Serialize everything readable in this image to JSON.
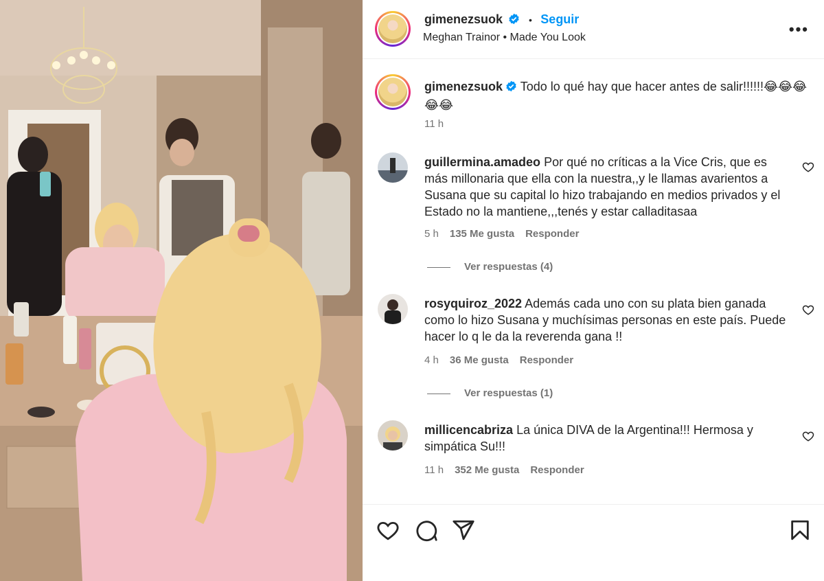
{
  "post": {
    "author": "gimenezsuok",
    "follow_label": "Seguir",
    "dot": "•",
    "song": "Meghan Trainor • Made You Look",
    "more_label": "•••",
    "caption": "Todo lo qué hay que hacer antes de salir!!!!!!😂😂😂😂😂",
    "caption_time": "11 h"
  },
  "comments": [
    {
      "user": "guillermina.amadeo",
      "text": "Por qué no críticas a la Vice Cris, que es más millonaria que ella con la nuestra,,y le llamas avarientos a Susana que su capital lo hizo trabajando en medios privados y el Estado no la mantiene,,,tenés y estar calladitasaa",
      "time": "5 h",
      "likes": "135 Me gusta",
      "reply": "Responder",
      "view_replies": "Ver respuestas (4)"
    },
    {
      "user": "rosyquiroz_2022",
      "text": "Además cada uno con su plata bien ganada como lo hizo Susana y muchísimas personas en este país. Puede hacer lo q le da la reverenda gana !!",
      "time": "4 h",
      "likes": "36 Me gusta",
      "reply": "Responder",
      "view_replies": "Ver respuestas (1)"
    },
    {
      "user": "millicencabriza",
      "text": "La única DIVA de la Argentina!!! Hermosa y simpática Su!!!",
      "time": "11 h",
      "likes": "352 Me gusta",
      "reply": "Responder"
    }
  ],
  "actions": {
    "like_icon": "heart-icon",
    "comment_icon": "comment-icon",
    "share_icon": "share-icon",
    "save_icon": "bookmark-icon"
  },
  "colors": {
    "link": "#0095f6",
    "muted": "#737373",
    "text": "#262626"
  }
}
